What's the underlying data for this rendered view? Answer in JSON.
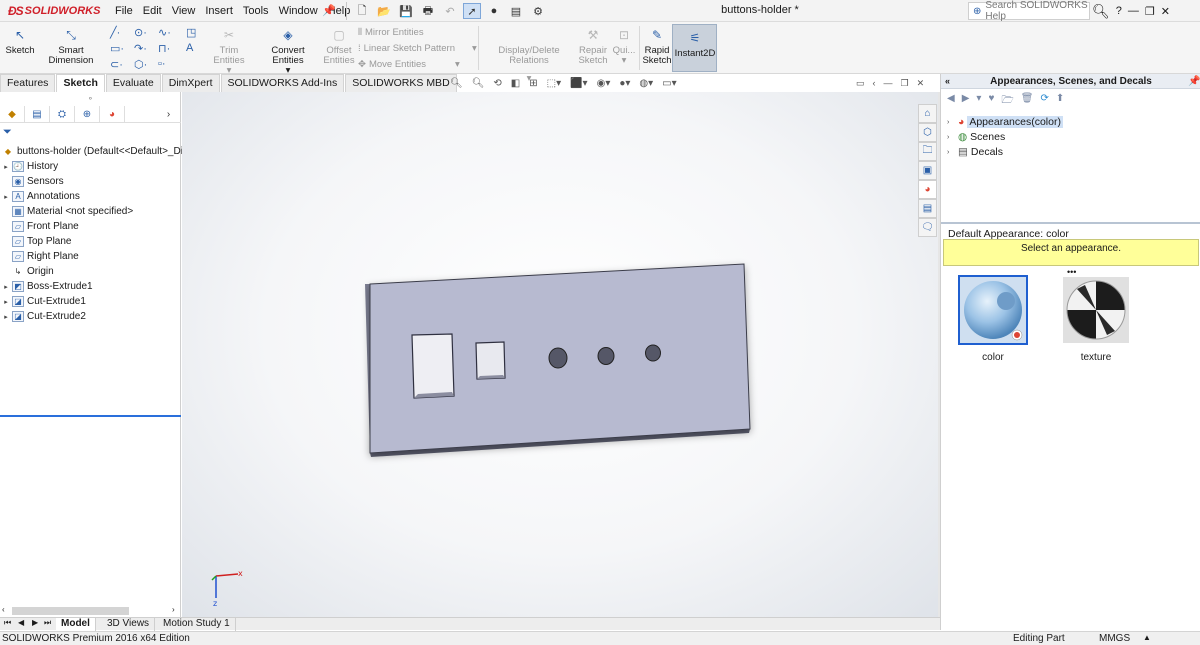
{
  "app": {
    "brand": "SOLIDWORKS",
    "doc_title": "buttons-holder *"
  },
  "menu": [
    "File",
    "Edit",
    "View",
    "Insert",
    "Tools",
    "Window",
    "Help"
  ],
  "search": {
    "placeholder": "Search SOLIDWORKS Help"
  },
  "commands": {
    "sketch": "Sketch",
    "smart_dimension": "Smart Dimension",
    "trim_entities": "Trim Entities",
    "convert_entities": "Convert Entities",
    "offset_entities": "Offset Entities",
    "mirror_entities": "Mirror Entities",
    "linear_sketch_pattern": "Linear Sketch Pattern",
    "move_entities": "Move Entities",
    "display_delete_relations": "Display/Delete Relations",
    "repair_sketch": "Repair Sketch",
    "quick_snaps": "Qui...",
    "rapid_sketch": "Rapid Sketch",
    "instant2d": "Instant2D"
  },
  "tabs": [
    "Features",
    "Sketch",
    "Evaluate",
    "DimXpert",
    "SOLIDWORKS Add-Ins",
    "SOLIDWORKS MBD"
  ],
  "active_tab": "Sketch",
  "feature_tree": {
    "root": "buttons-holder  (Default<<Default>_Di",
    "items": [
      {
        "label": "History",
        "expandable": true,
        "icon": "history-icon"
      },
      {
        "label": "Sensors",
        "expandable": false,
        "icon": "sensor-icon"
      },
      {
        "label": "Annotations",
        "expandable": true,
        "icon": "annotation-icon"
      },
      {
        "label": "Material <not specified>",
        "expandable": false,
        "icon": "material-icon"
      },
      {
        "label": "Front Plane",
        "expandable": false,
        "icon": "plane-icon"
      },
      {
        "label": "Top Plane",
        "expandable": false,
        "icon": "plane-icon"
      },
      {
        "label": "Right Plane",
        "expandable": false,
        "icon": "plane-icon"
      },
      {
        "label": "Origin",
        "expandable": false,
        "icon": "origin-icon"
      },
      {
        "label": "Boss-Extrude1",
        "expandable": true,
        "icon": "extrude-icon"
      },
      {
        "label": "Cut-Extrude1",
        "expandable": true,
        "icon": "cut-extrude-icon"
      },
      {
        "label": "Cut-Extrude2",
        "expandable": true,
        "icon": "cut-extrude-icon"
      }
    ]
  },
  "task_pane": {
    "title": "Appearances, Scenes, and Decals",
    "tree": [
      {
        "label": "Appearances(color)",
        "selected": true
      },
      {
        "label": "Scenes",
        "selected": false
      },
      {
        "label": "Decals",
        "selected": false
      }
    ],
    "default_appearance": "Default Appearance: color",
    "message": "Select an appearance.",
    "swatches": [
      {
        "label": "color",
        "selected": true
      },
      {
        "label": "texture",
        "selected": false
      }
    ]
  },
  "bottom_tabs": [
    "Model",
    "3D Views",
    "Motion Study 1"
  ],
  "active_bottom_tab": "Model",
  "status": {
    "product": "SOLIDWORKS Premium 2016 x64 Edition",
    "mode": "Editing Part",
    "units": "MMGS"
  },
  "colors": {
    "brand_red": "#d0202a",
    "selection_blue": "#1f5fd0",
    "part_face": "#b7bad0",
    "message_yellow": "#ffff99"
  }
}
